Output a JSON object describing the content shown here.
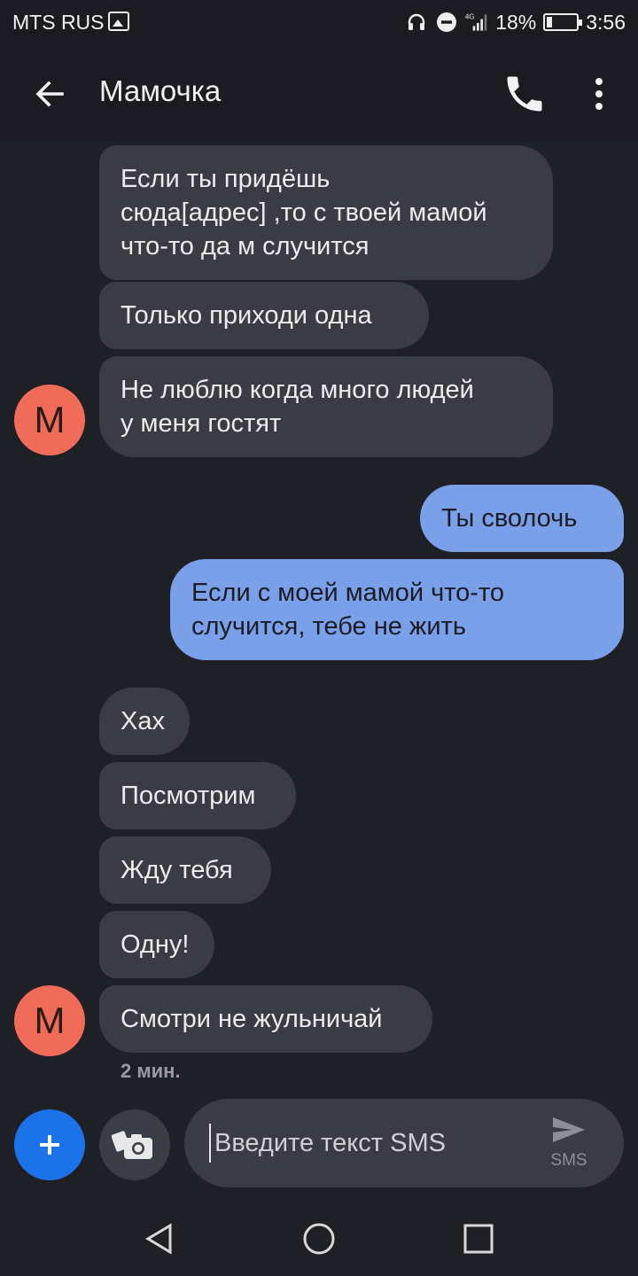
{
  "status_bar": {
    "carrier": "MTS RUS",
    "network": "4G",
    "battery_percent": "18%",
    "battery_level": 0.18,
    "time": "3:56"
  },
  "app_bar": {
    "title": "Мамочка"
  },
  "contact": {
    "avatar_letter": "M",
    "avatar_color": "#f06c58"
  },
  "messages": [
    {
      "direction": "incoming",
      "text": "Если ты придёшь\nсюда[адрес] ,то с твоей мамой\nчто-то да м случится"
    },
    {
      "direction": "incoming",
      "text": "Только приходи одна"
    },
    {
      "direction": "incoming",
      "text": "Не люблю когда много людей\nу меня гостят"
    },
    {
      "direction": "outgoing",
      "text": "Ты сволочь"
    },
    {
      "direction": "outgoing",
      "text": "Если с моей мамой что-то\nслучится, тебе не жить"
    },
    {
      "direction": "incoming",
      "text": "Хах"
    },
    {
      "direction": "incoming",
      "text": "Посмотрим"
    },
    {
      "direction": "incoming",
      "text": "Жду тебя"
    },
    {
      "direction": "incoming",
      "text": "Одну!"
    },
    {
      "direction": "incoming",
      "text": "Смотри не жульничай"
    }
  ],
  "last_timestamp": "2 мин.",
  "compose": {
    "placeholder": "Введите текст SMS",
    "send_label": "SMS"
  },
  "colors": {
    "incoming_bubble": "#3b3c43",
    "outgoing_bubble": "#79a0e8",
    "add_button": "#1a73e8",
    "background": "#1f1f26"
  }
}
